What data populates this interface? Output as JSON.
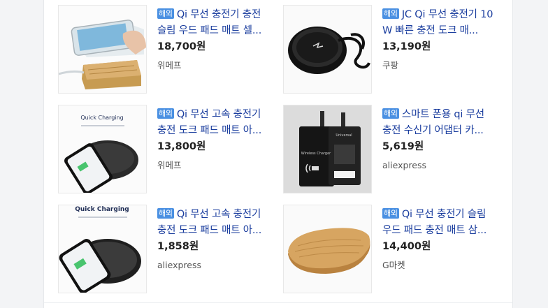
{
  "products": [
    {
      "badge": "해외",
      "title": "Qi 무선 충전기 충전 슬림 우드 패드 매트 셀...",
      "price": "18,700원",
      "seller": "위메프",
      "image": "bamboo-wood-charger-with-phone"
    },
    {
      "badge": "해외",
      "title": "JC Qi 무선 충전기 10W 빠른 충전 도크 매...",
      "price": "13,190원",
      "seller": "쿠팡",
      "image": "black-round-charger-with-cable"
    },
    {
      "badge": "해외",
      "title": "Qi 무선 고속 충전기 충전 도크 패드 매트 아...",
      "price": "13,800원",
      "seller": "위메프",
      "image": "quick-charging-pad-with-phone",
      "image_text": {
        "headline": "Quick Charging"
      }
    },
    {
      "badge": "해외",
      "title": "스마트 폰용 qi 무선 충전 수신기 어댑터 카...",
      "price": "5,619원",
      "seller": "aliexpress",
      "image": "wireless-charging-receiver-cards",
      "image_text": {
        "left_card": "Wireless Charger",
        "right_card": "Universal"
      }
    },
    {
      "badge": "해외",
      "title": "Qi 무선 고속 충전기 충전 도크 패드 매트 아...",
      "price": "1,858원",
      "seller": "aliexpress",
      "image": "quick-charging-pad-with-phone",
      "image_text": {
        "headline": "Quick Charging"
      }
    },
    {
      "badge": "해외",
      "title": "Qi 무선 충전기 슬림 우드 패드 충전 매트 삼...",
      "price": "14,400원",
      "seller": "G마켓",
      "image": "bamboo-wood-charging-pad"
    }
  ]
}
